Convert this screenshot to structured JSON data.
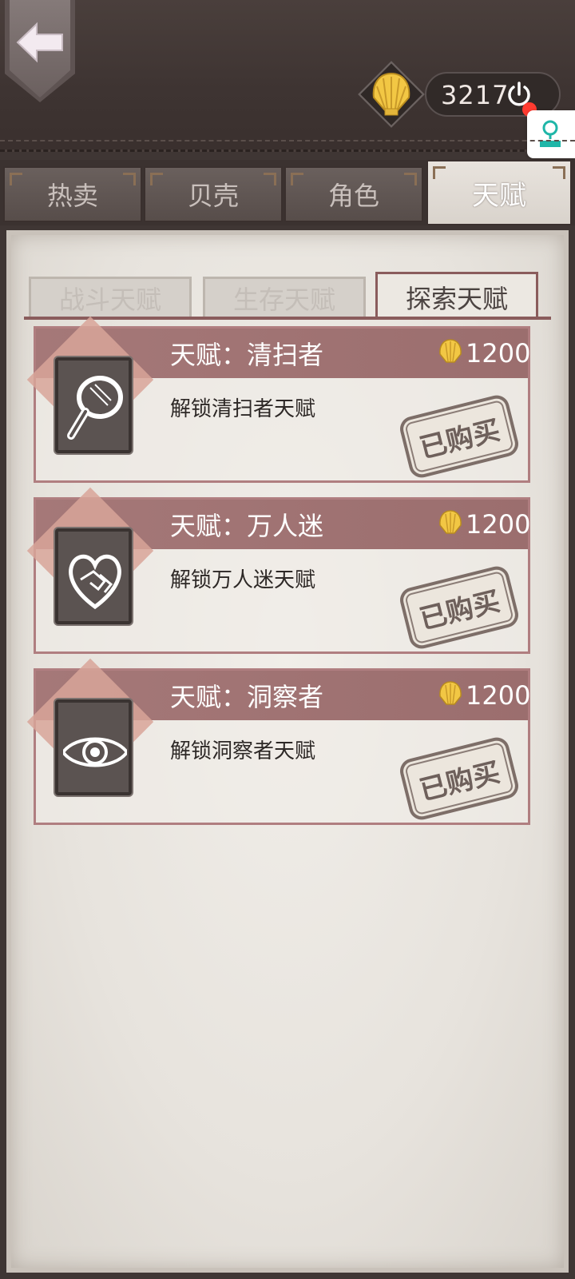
{
  "header": {
    "currency_amount": "3217"
  },
  "tabs": [
    {
      "label": "热卖",
      "active": false
    },
    {
      "label": "贝壳",
      "active": false
    },
    {
      "label": "角色",
      "active": false
    },
    {
      "label": "天赋",
      "active": true
    }
  ],
  "subtabs": [
    {
      "label": "战斗天赋",
      "active": false
    },
    {
      "label": "生存天赋",
      "active": false
    },
    {
      "label": "探索天赋",
      "active": true
    }
  ],
  "talents": [
    {
      "title": "天赋：清扫者",
      "price": "1200",
      "description": "解锁清扫者天赋",
      "status": "已购买",
      "icon": "magnifier-icon"
    },
    {
      "title": "天赋：万人迷",
      "price": "1200",
      "description": "解锁万人迷天赋",
      "status": "已购买",
      "icon": "heart-handshake-icon"
    },
    {
      "title": "天赋：洞察者",
      "price": "1200",
      "description": "解锁洞察者天赋",
      "status": "已购买",
      "icon": "eye-icon"
    }
  ],
  "colors": {
    "card_band": "#a57878",
    "paper": "#ece8e2",
    "leather": "#3f3634",
    "shell_gold": "#f2c744"
  }
}
